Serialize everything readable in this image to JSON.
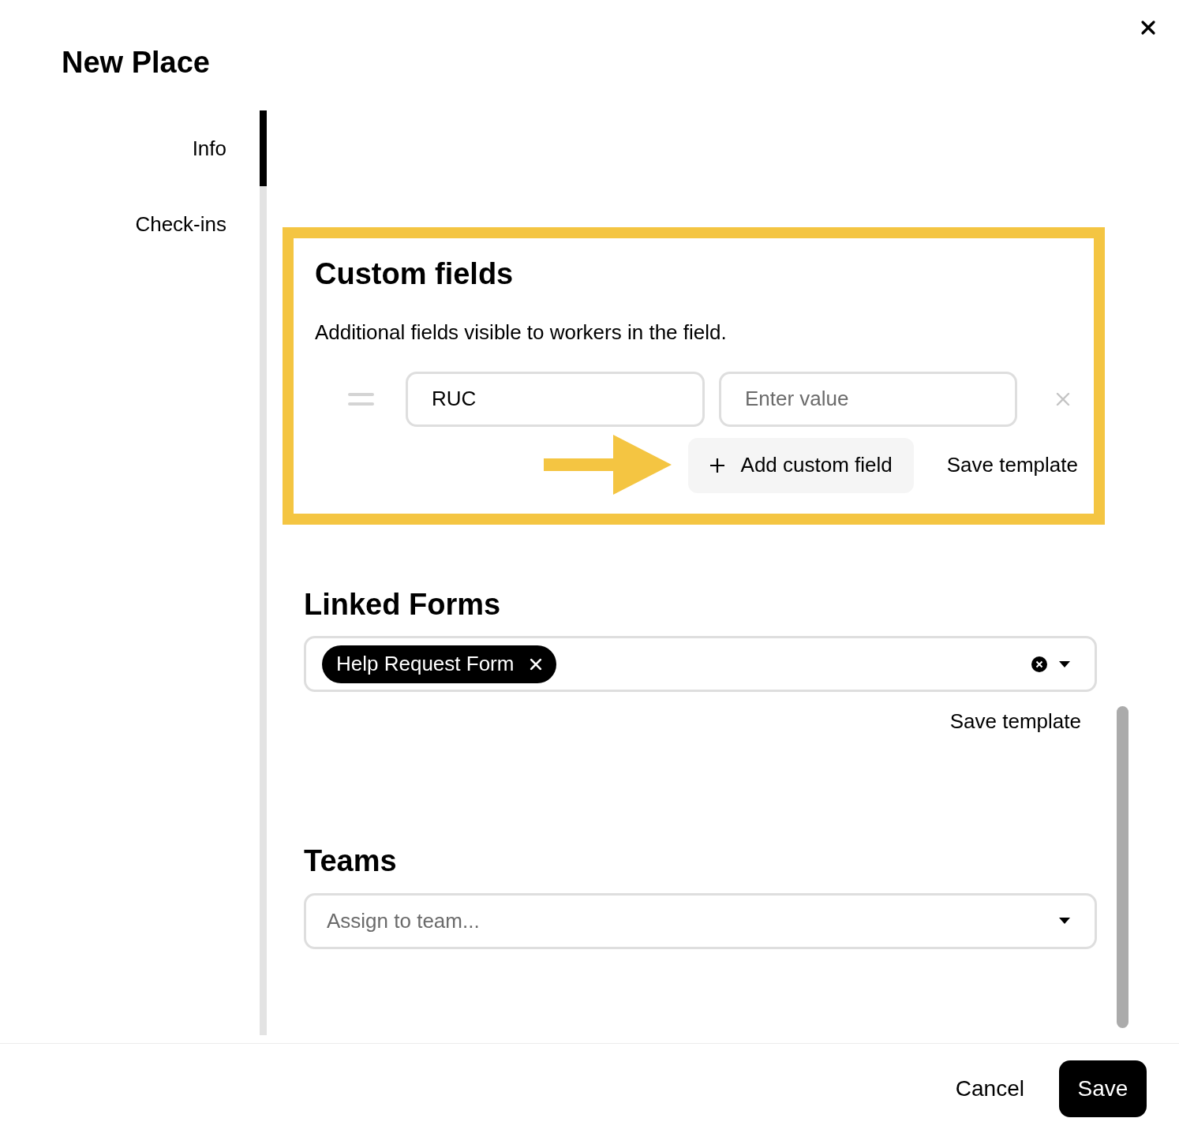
{
  "dialog": {
    "title": "New Place"
  },
  "tabs": [
    {
      "label": "Info",
      "selected": true
    },
    {
      "label": "Check-ins",
      "selected": false
    }
  ],
  "custom_fields": {
    "title": "Custom fields",
    "description": "Additional fields visible to workers in the field.",
    "highlighted": true,
    "rows": [
      {
        "name": "RUC",
        "placeholder": "Enter value"
      }
    ],
    "add_button": "Add custom field",
    "save_template": "Save template"
  },
  "linked_forms": {
    "title": "Linked Forms",
    "chips": [
      "Help Request Form"
    ],
    "save_template": "Save template"
  },
  "teams": {
    "title": "Teams",
    "placeholder": "Assign to team..."
  },
  "footer": {
    "cancel": "Cancel",
    "save": "Save"
  }
}
